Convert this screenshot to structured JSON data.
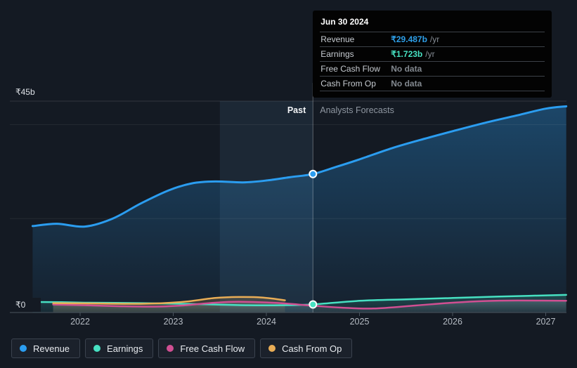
{
  "tooltip": {
    "title": "Jun 30 2024",
    "rows": [
      {
        "label": "Revenue",
        "value": "₹29.487b",
        "suffix": "/yr",
        "color": "#2e9fe8"
      },
      {
        "label": "Earnings",
        "value": "₹1.723b",
        "suffix": "/yr",
        "color": "#47e1c2"
      },
      {
        "label": "Free Cash Flow",
        "value": "No data",
        "suffix": "",
        "color": "#82888f"
      },
      {
        "label": "Cash From Op",
        "value": "No data",
        "suffix": "",
        "color": "#82888f"
      }
    ]
  },
  "plot_labels": {
    "past": "Past",
    "forecast": "Analysts Forecasts",
    "y_max": "₹45b",
    "y_zero": "₹0"
  },
  "legend": [
    {
      "label": "Revenue",
      "color": "#2b9df0"
    },
    {
      "label": "Earnings",
      "color": "#47e1c2"
    },
    {
      "label": "Free Cash Flow",
      "color": "#d04f92"
    },
    {
      "label": "Cash From Op",
      "color": "#e9ad56"
    }
  ],
  "chart_data": {
    "type": "area",
    "currency_unit": "₹ billions",
    "x_axis": {
      "ticks": [
        {
          "year": 2022,
          "label": "2022"
        },
        {
          "year": 2023,
          "label": "2023"
        },
        {
          "year": 2024,
          "label": "2024"
        },
        {
          "year": 2025,
          "label": "2025"
        },
        {
          "year": 2026,
          "label": "2026"
        },
        {
          "year": 2027,
          "label": "2027"
        }
      ],
      "range": [
        2021.25,
        2027.25
      ]
    },
    "y_axis": {
      "range": [
        0,
        45
      ],
      "unit": "b",
      "gridlines": [
        0,
        20,
        40,
        45
      ],
      "labeled_gridlines": {
        "45": "₹45b",
        "0": "₹0"
      }
    },
    "divider_year": 2024.5,
    "highlight_band_years": [
      2023.5,
      2024.5
    ],
    "legend_position": "bottom-left",
    "series": [
      {
        "name": "Revenue",
        "color": "#2b9df0",
        "width": 3,
        "fill": {
          "color": "#2b9df0",
          "top_opacity": 0.34,
          "bottom_opacity": 0.05
        },
        "points": [
          [
            2021.49,
            18.4
          ],
          [
            2021.75,
            18.9
          ],
          [
            2022.05,
            18.3
          ],
          [
            2022.35,
            20.0
          ],
          [
            2022.65,
            23.2
          ],
          [
            2022.95,
            26.0
          ],
          [
            2023.2,
            27.5
          ],
          [
            2023.45,
            27.9
          ],
          [
            2023.75,
            27.7
          ],
          [
            2024.0,
            28.1
          ],
          [
            2024.25,
            28.8
          ],
          [
            2024.5,
            29.487
          ],
          [
            2024.75,
            31.0
          ],
          [
            2025.0,
            32.6
          ],
          [
            2025.35,
            35.0
          ],
          [
            2025.7,
            37.0
          ],
          [
            2026.0,
            38.6
          ],
          [
            2026.35,
            40.4
          ],
          [
            2026.7,
            42.0
          ],
          [
            2027.0,
            43.4
          ],
          [
            2027.22,
            43.9
          ]
        ]
      },
      {
        "name": "Earnings",
        "color": "#47e1c2",
        "width": 2.5,
        "fill": {
          "color": "#47e1c2",
          "top_opacity": 0.2,
          "bottom_opacity": 0.05
        },
        "points": [
          [
            2021.49,
            2.25
          ],
          [
            2021.8,
            2.2
          ],
          [
            2022.05,
            2.1
          ],
          [
            2022.65,
            2.0
          ],
          [
            2023.1,
            1.85
          ],
          [
            2023.45,
            1.7
          ],
          [
            2023.8,
            1.55
          ],
          [
            2024.15,
            1.55
          ],
          [
            2024.5,
            1.723
          ],
          [
            2025.0,
            2.5
          ],
          [
            2025.5,
            2.8
          ],
          [
            2026.0,
            3.1
          ],
          [
            2026.5,
            3.4
          ],
          [
            2027.22,
            3.75
          ]
        ]
      },
      {
        "name": "Free Cash Flow",
        "color": "#d04f92",
        "width": 2.5,
        "fill": {
          "color": "#c2cbd8",
          "top_opacity": 0.22,
          "bottom_opacity": 0.08
        },
        "points": [
          [
            2021.71,
            1.7
          ],
          [
            2022.05,
            1.55
          ],
          [
            2022.4,
            1.35
          ],
          [
            2022.8,
            1.25
          ],
          [
            2023.1,
            1.5
          ],
          [
            2023.45,
            2.1
          ],
          [
            2023.7,
            2.3
          ],
          [
            2024.1,
            2.05
          ],
          [
            2024.5,
            1.45
          ],
          [
            2024.8,
            1.05
          ],
          [
            2025.15,
            0.85
          ],
          [
            2025.6,
            1.5
          ],
          [
            2026.0,
            2.1
          ],
          [
            2026.35,
            2.45
          ],
          [
            2026.7,
            2.55
          ],
          [
            2027.22,
            2.5
          ]
        ]
      },
      {
        "name": "Cash From Op",
        "color": "#e9ad56",
        "width": 2.5,
        "fill": {
          "color": "#e9ad56",
          "top_opacity": 0.22,
          "bottom_opacity": 0.08
        },
        "points": [
          [
            2021.71,
            2.0
          ],
          [
            2022.05,
            1.95
          ],
          [
            2022.65,
            1.85
          ],
          [
            2023.1,
            2.25
          ],
          [
            2023.45,
            3.1
          ],
          [
            2023.7,
            3.3
          ],
          [
            2023.95,
            3.2
          ],
          [
            2024.2,
            2.6
          ]
        ]
      }
    ],
    "markers": [
      {
        "series": "Revenue",
        "year": 2024.5,
        "value": 29.487,
        "color": "#2b9df0"
      },
      {
        "series": "Earnings",
        "year": 2024.5,
        "value": 1.723,
        "color": "#47e1c2"
      }
    ]
  }
}
